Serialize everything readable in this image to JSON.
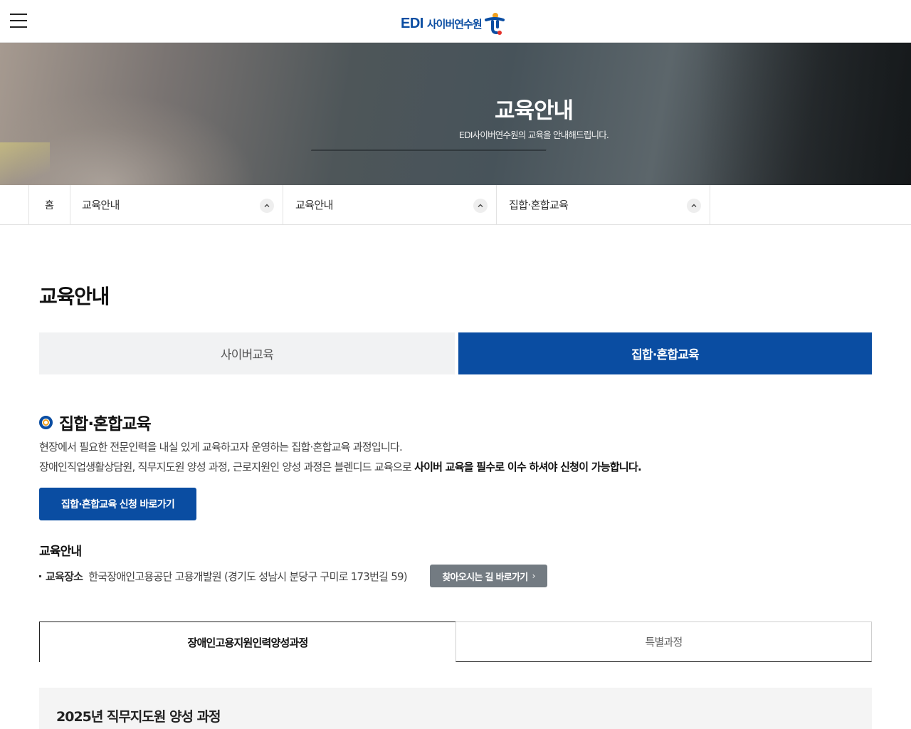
{
  "header": {
    "menu_icon": "hamburger-menu-icon",
    "logo_brand": "EDI",
    "logo_text": "사이버연수원",
    "logo_mark_colors": [
      "#0a4da2",
      "#f0a01e",
      "#e4322b"
    ]
  },
  "hero": {
    "title": "교육안내",
    "subtitle": "EDI사이버연수원의 교육을 안내해드립니다."
  },
  "breadcrumb": {
    "home": "홈",
    "items": [
      {
        "label": "교육안내",
        "icon": "chevron-up-icon"
      },
      {
        "label": "교육안내",
        "icon": "chevron-up-icon"
      },
      {
        "label": "집합·혼합교육",
        "icon": "chevron-up-icon"
      }
    ]
  },
  "main": {
    "page_title": "교육안내",
    "tabs": [
      {
        "label": "사이버교육",
        "active": false
      },
      {
        "label": "집합·혼합교육",
        "active": true
      }
    ],
    "section_title": "집합·혼합교육",
    "desc_line1": "현장에서 필요한 전문인력을 내실 있게 교육하고자 운영하는 집합·혼합교육 과정입니다.",
    "desc_line2_plain": "장애인직업생활상담원, 직무지도원 양성 과정, 근로지원인 양성 과정은 블렌디드 교육으로 ",
    "desc_line2_bold": "사이버 교육을 필수로 이수 하셔야 신청이 가능합니다.",
    "apply_button": "집합·혼합교육 신청 바로가기",
    "info_title": "교육안내",
    "info_label": "교육장소",
    "info_value": "한국장애인고용공단 고용개발원 (경기도 성남시 분당구 구미로 173번길 59)",
    "map_button": "찾아오시는 길 바로가기",
    "sub_tabs": [
      {
        "label": "장애인고용지원인력양성과정",
        "active": true
      },
      {
        "label": "특별과정",
        "active": false
      }
    ],
    "course_title": "2025년 직무지도원 양성 과정"
  },
  "colors": {
    "accent": "#0a4da2",
    "inactive_tab_bg": "#f1f2f3",
    "map_button_bg": "#737b82"
  }
}
